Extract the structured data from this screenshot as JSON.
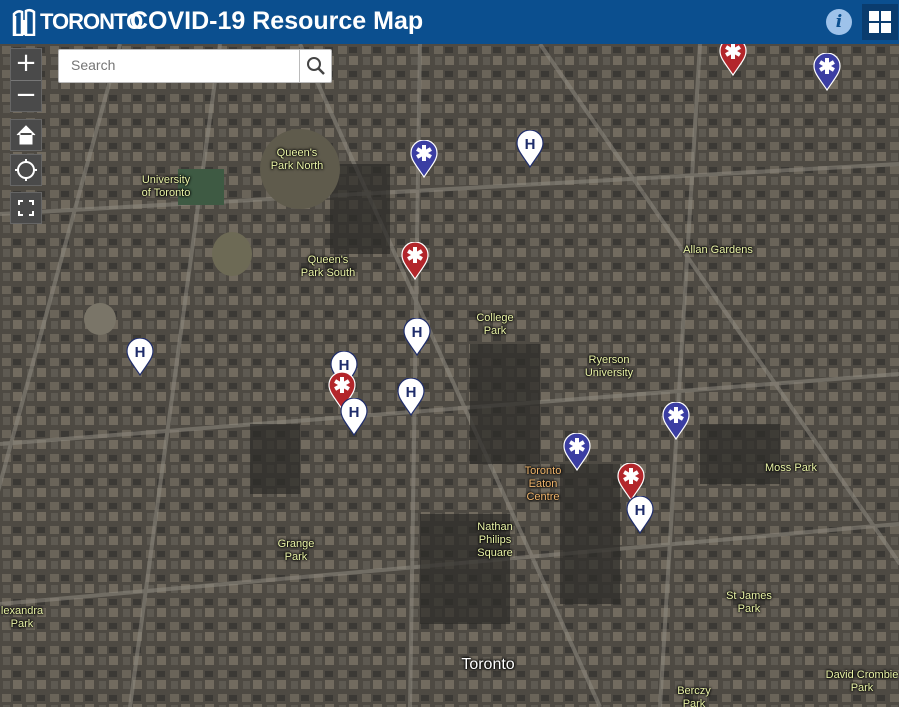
{
  "header": {
    "logo_text": "TORONTO",
    "title": "COVID-19 Resource Map",
    "info_icon": "info-icon",
    "grid_icon": "app-grid-icon",
    "bar_color": "#0b4f8f"
  },
  "search": {
    "placeholder": "Search",
    "icon": "search-icon"
  },
  "controls": {
    "zoom_in": "+",
    "zoom_out": "−",
    "home_icon": "home-icon",
    "locate_icon": "locate-icon",
    "fullscreen_icon": "fullscreen-icon"
  },
  "map": {
    "basemap": "satellite imagery",
    "place_labels": [
      {
        "id": "queens-park-north",
        "text": "Queen's\nPark North"
      },
      {
        "id": "university-of-toronto",
        "text": "University\nof Toronto"
      },
      {
        "id": "queens-park-south",
        "text": "Queen's\nPark South"
      },
      {
        "id": "allan-gardens",
        "text": "Allan Gardens"
      },
      {
        "id": "college-park",
        "text": "College\nPark"
      },
      {
        "id": "ryerson-university",
        "text": "Ryerson\nUniversity"
      },
      {
        "id": "moss-park",
        "text": "Moss Park"
      },
      {
        "id": "toronto-eaton-centre",
        "text": "Toronto\nEaton\nCentre"
      },
      {
        "id": "nathan-phillips-square",
        "text": "Nathan\nPhilips\nSquare"
      },
      {
        "id": "grange-park",
        "text": "Grange\nPark"
      },
      {
        "id": "alexandra-park",
        "text": "lexandra\nPark"
      },
      {
        "id": "st-james-park",
        "text": "St James\nPark"
      },
      {
        "id": "toronto",
        "text": "Toronto"
      },
      {
        "id": "berczy-park",
        "text": "Berczy\nPark"
      },
      {
        "id": "david-crombie-park",
        "text": "David Crombie\nPark"
      }
    ],
    "marker_types": {
      "hospital": {
        "glyph": "H",
        "color": "#ffffff"
      },
      "assessment-centre": {
        "glyph": "star-of-life",
        "color": "#3b3ea3"
      },
      "testing-site": {
        "glyph": "star-of-life",
        "color": "#b3262b"
      }
    },
    "markers": [
      {
        "type": "testing-site"
      },
      {
        "type": "assessment-centre"
      },
      {
        "type": "assessment-centre"
      },
      {
        "type": "hospital"
      },
      {
        "type": "testing-site"
      },
      {
        "type": "hospital"
      },
      {
        "type": "hospital"
      },
      {
        "type": "hospital"
      },
      {
        "type": "testing-site"
      },
      {
        "type": "hospital"
      },
      {
        "type": "hospital"
      },
      {
        "type": "assessment-centre"
      },
      {
        "type": "assessment-centre"
      },
      {
        "type": "testing-site"
      },
      {
        "type": "hospital"
      }
    ]
  }
}
